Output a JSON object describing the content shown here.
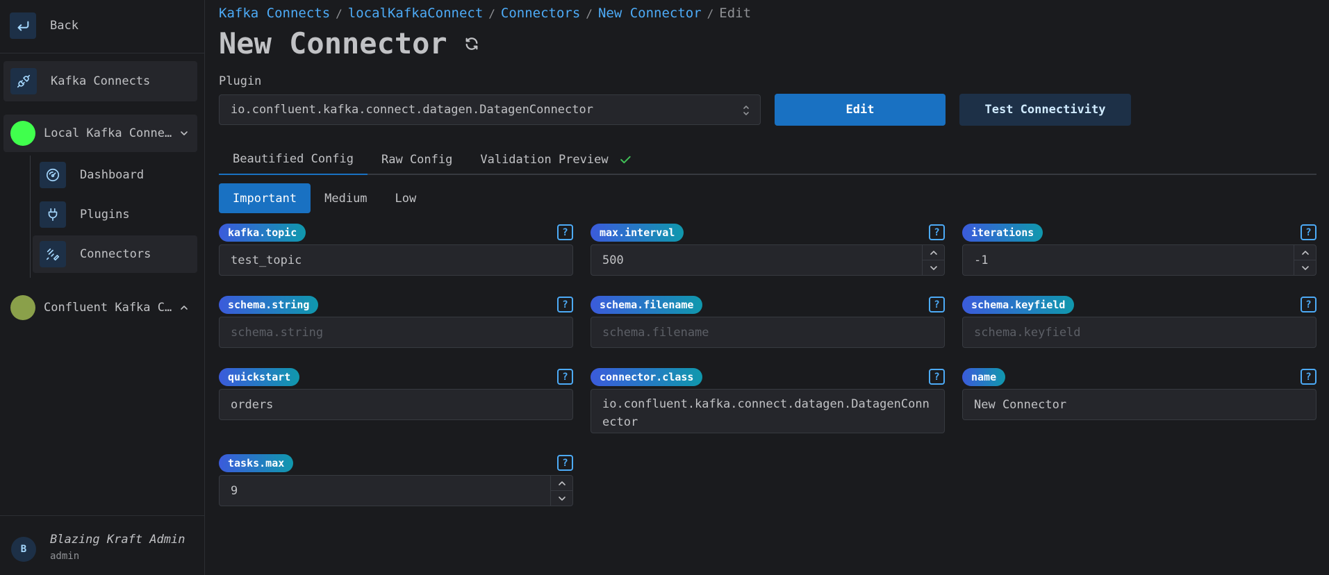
{
  "sidebar": {
    "back_label": "Back",
    "kafka_connects_label": "Kafka Connects",
    "clusters": [
      {
        "label": "Local Kafka Connect",
        "color": "#40ff4d"
      },
      {
        "label": "Confluent Kafka Connect",
        "color": "#8aa04a"
      }
    ],
    "sub_items": [
      {
        "label": "Dashboard",
        "icon": "gauge-icon"
      },
      {
        "label": "Plugins",
        "icon": "plug-icon"
      },
      {
        "label": "Connectors",
        "icon": "connectors-icon"
      }
    ],
    "user": {
      "initial": "B",
      "name": "Blazing Kraft Admin",
      "role": "admin"
    }
  },
  "breadcrumb": {
    "items": [
      "Kafka Connects",
      "localKafkaConnect",
      "Connectors",
      "New Connector"
    ],
    "current": "Edit"
  },
  "page": {
    "title": "New Connector",
    "plugin_label": "Plugin",
    "plugin_value": "io.confluent.kafka.connect.datagen.DatagenConnector",
    "edit_button": "Edit",
    "test_button": "Test Connectivity"
  },
  "tabs": [
    "Beautified Config",
    "Raw Config",
    "Validation Preview"
  ],
  "subtabs": [
    "Important",
    "Medium",
    "Low"
  ],
  "fields": [
    {
      "label": "kafka.topic",
      "value": "test_topic",
      "placeholder": ""
    },
    {
      "label": "max.interval",
      "value": "500",
      "placeholder": ""
    },
    {
      "label": "iterations",
      "value": "-1",
      "placeholder": ""
    },
    {
      "label": "schema.string",
      "value": "",
      "placeholder": "schema.string"
    },
    {
      "label": "schema.filename",
      "value": "",
      "placeholder": "schema.filename"
    },
    {
      "label": "schema.keyfield",
      "value": "",
      "placeholder": "schema.keyfield"
    },
    {
      "label": "quickstart",
      "value": "orders",
      "placeholder": ""
    },
    {
      "label": "connector.class",
      "value": "io.confluent.kafka.connect.datagen.DatagenConnector",
      "placeholder": ""
    },
    {
      "label": "name",
      "value": "New Connector",
      "placeholder": ""
    },
    {
      "label": "tasks.max",
      "value": "9",
      "placeholder": ""
    }
  ],
  "colors": {
    "accent": "#1971c2",
    "link": "#4dabf7",
    "success": "#40c057"
  }
}
